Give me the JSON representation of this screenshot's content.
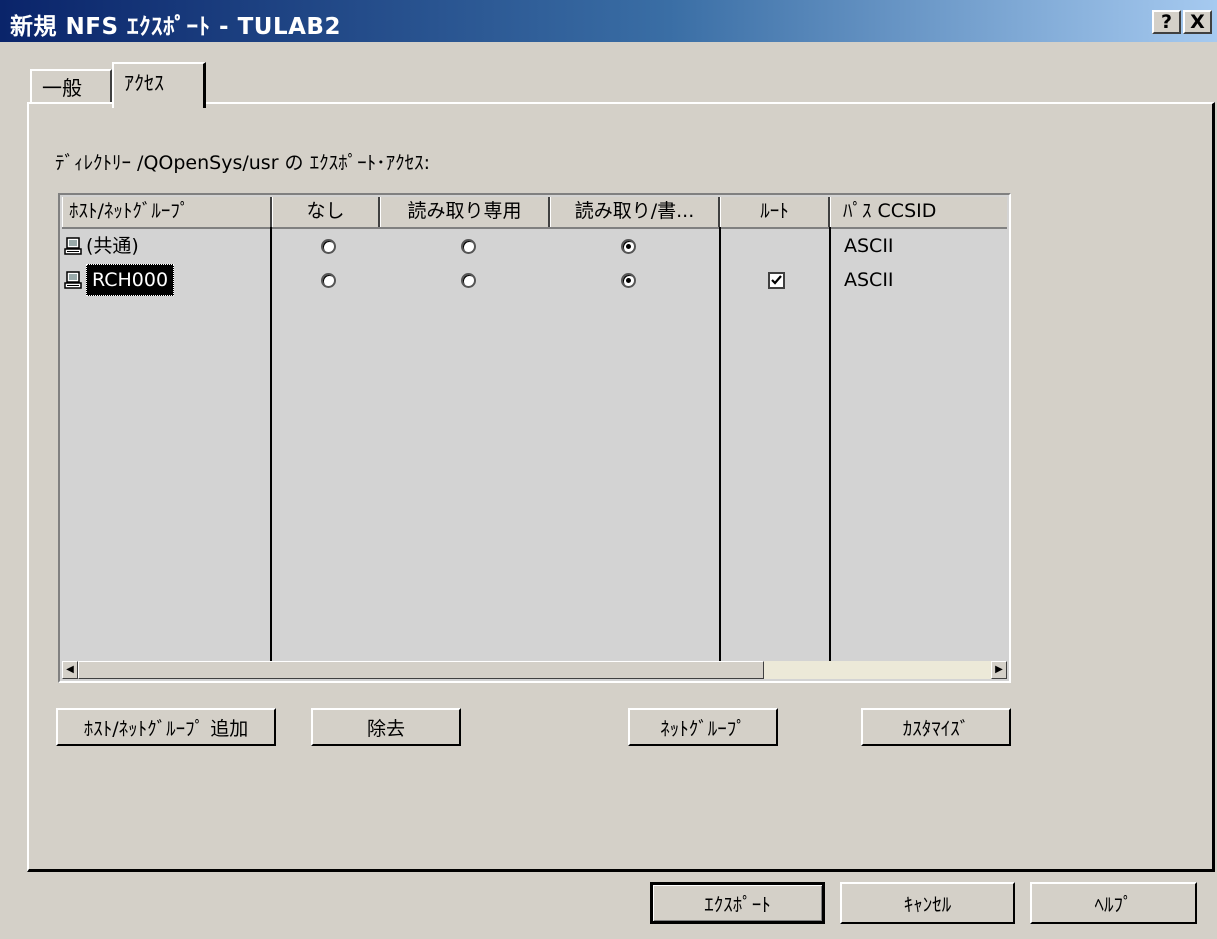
{
  "window": {
    "title": "新規 NFS ｴｸｽﾎﾟｰﾄ - TULAB2",
    "help_button": "?",
    "close_button": "X"
  },
  "tabs": [
    {
      "label": "一般",
      "active": false
    },
    {
      "label": "ｱｸｾｽ",
      "active": true
    }
  ],
  "access": {
    "directory_label": "ﾃﾞｨﾚｸﾄﾘｰ /QOpenSys/usr の ｴｸｽﾎﾟｰﾄ･ｱｸｾｽ:",
    "columns": [
      "ﾎｽﾄ/ﾈｯﾄｸﾞﾙｰﾌﾟ",
      "なし",
      "読み取り専用",
      "読み取り/書...",
      "ﾙｰﾄ",
      "ﾊﾟｽ CCSID"
    ],
    "rows": [
      {
        "host": "(共通)",
        "access": "読み取り/書...",
        "root": false,
        "root_visible": false,
        "ccsid": "ASCII",
        "selected": false
      },
      {
        "host": "RCH000",
        "access": "読み取り/書...",
        "root": true,
        "root_visible": true,
        "ccsid": "ASCII",
        "selected": true
      }
    ],
    "icons": {
      "host": "computer-icon",
      "scroll_left": "arrow-left-icon",
      "scroll_right": "arrow-right-icon"
    }
  },
  "buttons": {
    "add_host": "ﾎｽﾄ/ﾈｯﾄｸﾞﾙｰﾌﾟ 追加",
    "remove": "除去",
    "netgroup": "ﾈｯﾄｸﾞﾙｰﾌﾟ",
    "customize": "ｶｽﾀﾏｲｽﾞ",
    "export": "ｴｸｽﾎﾟｰﾄ",
    "cancel": "ｷｬﾝｾﾙ",
    "help": "ﾍﾙﾌﾟ"
  },
  "colors": {
    "titlebar_start": "#0a246a",
    "titlebar_end": "#a6caf0",
    "face": "#d4d0c8",
    "list_bg": "#d3d3d3"
  }
}
